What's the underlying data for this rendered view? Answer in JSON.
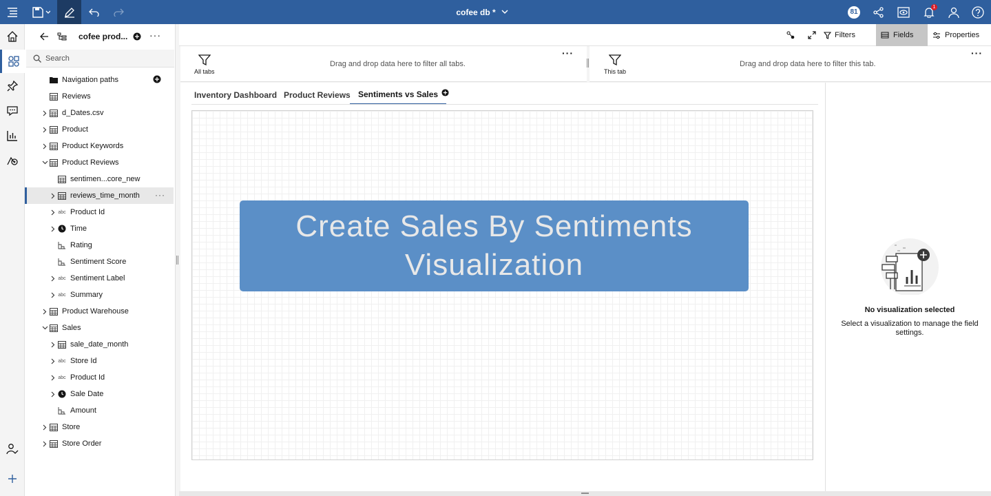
{
  "topbar": {
    "title": "cofee db *",
    "user_badge": "81",
    "notification_count": "1",
    "colors": {
      "bar": "#2f5f9e",
      "alert": "#da1e28"
    }
  },
  "rail": {
    "items": [
      "home-icon",
      "data-icon",
      "pin-icon",
      "comment-icon",
      "chart-icon",
      "visualization-icon",
      "user-check-icon",
      "add-icon"
    ]
  },
  "datapanel": {
    "source_name": "cofee prod...",
    "search_placeholder": "Search",
    "tree": [
      {
        "label": "Navigation paths",
        "icon": "folder-icon",
        "expander": "none",
        "indent": 0
      },
      {
        "label": "Reviews",
        "icon": "table-icon",
        "expander": "none",
        "indent": 0
      },
      {
        "label": "d_Dates.csv",
        "icon": "table-icon",
        "expander": "right",
        "indent": 0
      },
      {
        "label": "Product",
        "icon": "table-icon",
        "expander": "right",
        "indent": 0
      },
      {
        "label": "Product Keywords",
        "icon": "table-icon",
        "expander": "right",
        "indent": 0
      },
      {
        "label": "Product Reviews",
        "icon": "table-icon",
        "expander": "down",
        "indent": 0
      },
      {
        "label": "sentimen...core_new",
        "icon": "table-icon",
        "expander": "none",
        "indent": 1
      },
      {
        "label": "reviews_time_month",
        "icon": "table-icon",
        "expander": "right",
        "indent": 1,
        "selected": true
      },
      {
        "label": "Product Id",
        "icon": "abc-icon",
        "expander": "right",
        "indent": 1
      },
      {
        "label": "Time",
        "icon": "clock-icon",
        "expander": "right",
        "indent": 1
      },
      {
        "label": "Rating",
        "icon": "measure-icon",
        "expander": "none",
        "indent": 1
      },
      {
        "label": "Sentiment Score",
        "icon": "measure-icon",
        "expander": "none",
        "indent": 1
      },
      {
        "label": "Sentiment Label",
        "icon": "abc-icon",
        "expander": "right",
        "indent": 1
      },
      {
        "label": "Summary",
        "icon": "abc-icon",
        "expander": "right",
        "indent": 1
      },
      {
        "label": "Product Warehouse",
        "icon": "table-icon",
        "expander": "right",
        "indent": 0
      },
      {
        "label": "Sales",
        "icon": "table-icon",
        "expander": "down",
        "indent": 0
      },
      {
        "label": "sale_date_month",
        "icon": "table-icon",
        "expander": "right",
        "indent": 1
      },
      {
        "label": "Store Id",
        "icon": "abc-icon",
        "expander": "right",
        "indent": 1
      },
      {
        "label": "Product Id",
        "icon": "abc-icon",
        "expander": "right",
        "indent": 1
      },
      {
        "label": "Sale Date",
        "icon": "clock-icon",
        "expander": "right",
        "indent": 1
      },
      {
        "label": "Amount",
        "icon": "measure-icon",
        "expander": "none",
        "indent": 1
      },
      {
        "label": "Store",
        "icon": "table-icon",
        "expander": "right",
        "indent": 0
      },
      {
        "label": "Store Order",
        "icon": "table-icon",
        "expander": "right",
        "indent": 0
      }
    ]
  },
  "toolbar": {
    "filters_label": "Filters",
    "fields_label": "Fields",
    "properties_label": "Properties"
  },
  "filters": {
    "all_tabs_caption": "All tabs",
    "all_tabs_hint": "Drag and drop data here to filter all tabs.",
    "this_tab_caption": "This tab",
    "this_tab_hint": "Drag and drop data here to filter this tab."
  },
  "tabs": [
    {
      "label": "Inventory Dashboard",
      "active": false
    },
    {
      "label": "Product Reviews",
      "active": false
    },
    {
      "label": "Sentiments vs Sales",
      "active": true
    }
  ],
  "canvas": {
    "banner_text": "Create Sales By Sentiments Visualization",
    "banner_color": "#5b8fc7"
  },
  "fields_panel": {
    "empty_title": "No visualization selected",
    "empty_desc": "Select a visualization to manage the field settings."
  }
}
